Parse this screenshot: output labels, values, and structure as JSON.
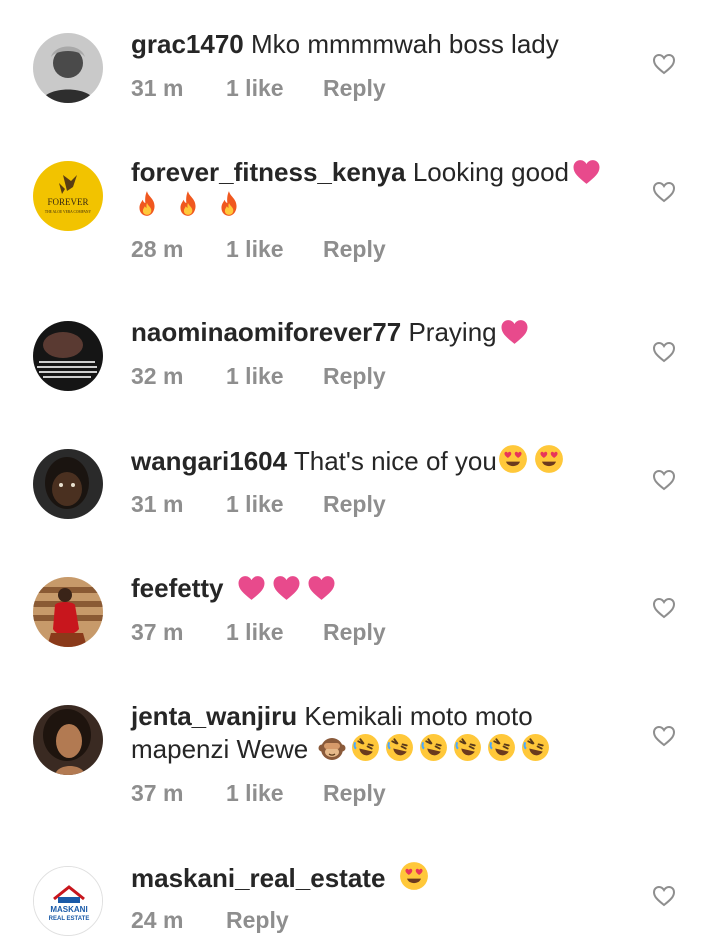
{
  "comments": [
    {
      "user": "grac1470",
      "text": "Mko mmmmwah boss lady",
      "time": "31 m",
      "likes": "1 like",
      "reply": "Reply"
    },
    {
      "user": "forever_fitness_kenya",
      "text": "Looking good",
      "time": "28 m",
      "likes": "1 like",
      "reply": "Reply",
      "avatar_logo": "FOREVER",
      "avatar_sub": "THE ALOE VERA COMPANY"
    },
    {
      "user": "naominaomiforever77",
      "text": "Praying",
      "time": "32 m",
      "likes": "1 like",
      "reply": "Reply"
    },
    {
      "user": "wangari1604",
      "text": "That's nice of you",
      "time": "31 m",
      "likes": "1 like",
      "reply": "Reply"
    },
    {
      "user": "feefetty",
      "text": "",
      "time": "37 m",
      "likes": "1 like",
      "reply": "Reply"
    },
    {
      "user": "jenta_wanjiru",
      "text": "Kemikali moto moto mapenzi Wewe",
      "time": "37 m",
      "likes": "1 like",
      "reply": "Reply"
    },
    {
      "user": "maskani_real_estate",
      "text": "",
      "time": "24 m",
      "likes": "",
      "reply": "Reply",
      "avatar_logo": "MASKANI",
      "avatar_sub": "REAL ESTATE"
    }
  ],
  "colors": {
    "text": "#262626",
    "meta": "#8e8e8e",
    "heart_pink": "#e84a8c",
    "like_outline": "#8e8e8e",
    "fire": "#f0581f",
    "emoji_face": "#ffc83a"
  },
  "icons": {
    "like": "heart-outline-icon",
    "heart": "red-heart-emoji",
    "fire": "fire-emoji",
    "heart_eyes": "smiling-face-with-heart-eyes-emoji",
    "see_no_evil": "see-no-evil-monkey-emoji",
    "rofl": "rolling-on-floor-laughing-emoji"
  }
}
